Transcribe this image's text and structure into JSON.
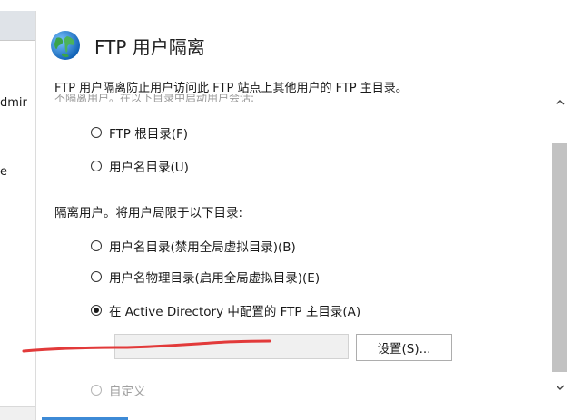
{
  "left_panel": {
    "fragment_1": "dmir",
    "fragment_2": "e"
  },
  "header": {
    "title": "FTP 用户隔离"
  },
  "description": "FTP 用户隔离防止用户访问此 FTP 站点上其他用户的 FTP 主目录。",
  "section_no_isolation": {
    "ghost_label": "不隔离用户。在以下目录中启动用户会话:",
    "options": [
      {
        "label": "FTP 根目录(F)",
        "checked": false
      },
      {
        "label": "用户名目录(U)",
        "checked": false
      }
    ]
  },
  "section_isolate": {
    "label": "隔离用户。将用户局限于以下目录:",
    "options": [
      {
        "label": "用户名目录(禁用全局虚拟目录)(B)",
        "checked": false
      },
      {
        "label": "用户名物理目录(启用全局虚拟目录)(E)",
        "checked": false
      },
      {
        "label": "在 Active Directory 中配置的 FTP 主目录(A)",
        "checked": true
      },
      {
        "label": "自定义",
        "checked": false,
        "disabled": true
      }
    ]
  },
  "ad_settings": {
    "button_label": "设置(S)...",
    "value": ""
  },
  "colors": {
    "annotation_stroke": "#e23a3a",
    "accent": "#3d8ad6"
  }
}
